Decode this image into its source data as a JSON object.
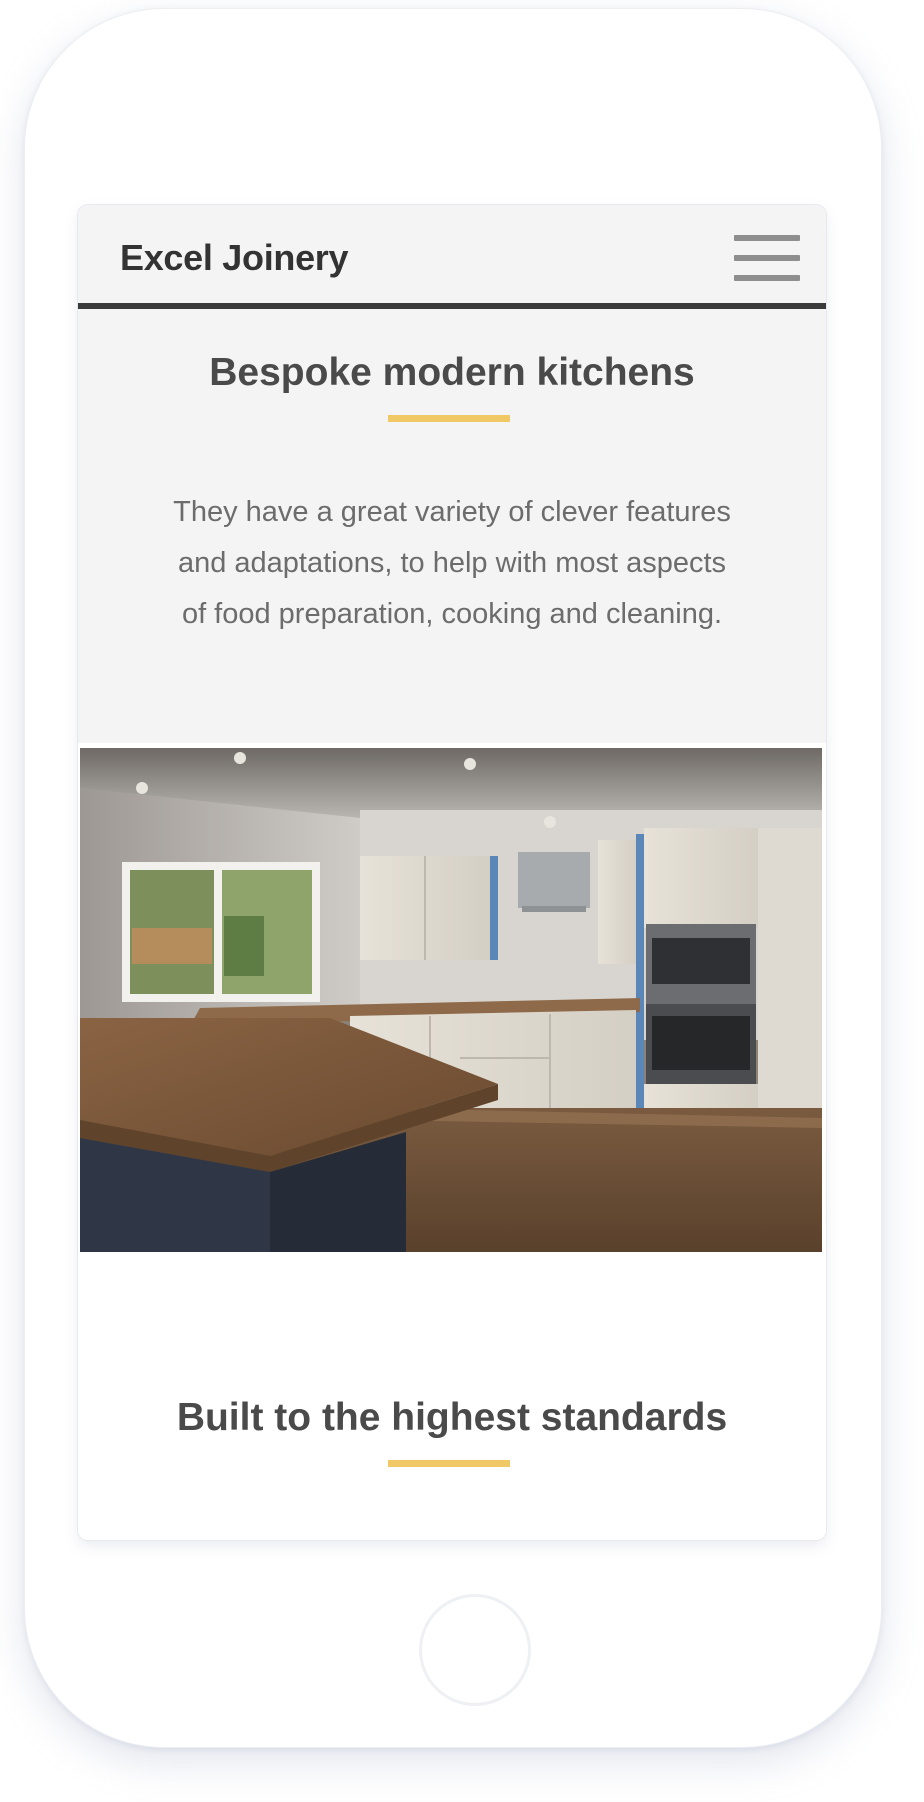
{
  "navbar": {
    "brand": "Excel Joinery",
    "menu_icon": "hamburger-menu-icon"
  },
  "section_kitchens": {
    "title": "Bespoke modern kitchens",
    "text": "They have a great variety of clever features and adaptations, to help with most aspects of food preparation, cooking and cleaning.",
    "accent_color": "#f0c866"
  },
  "section_standards": {
    "title": "Built to the highest standards",
    "accent_color": "#f0c866"
  },
  "device": {
    "home_button_icon": "home-button"
  }
}
